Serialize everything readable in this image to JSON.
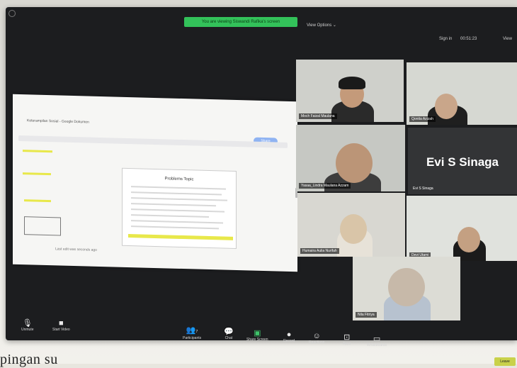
{
  "top": {
    "share_banner": "You are viewing Siswandi Rafika's screen",
    "view_options": "View Options ⌄",
    "sign_in": "Sign in",
    "timer": "00:51:23",
    "view": "View"
  },
  "shared_doc": {
    "tab_title": "Keterampilan Sosial - Google Dokumen",
    "share_button": "Share",
    "page_title": "Problems Topic",
    "status_text": "Last edit was seconds ago"
  },
  "participants": [
    {
      "name": "Moch Faizal Maulana"
    },
    {
      "name": "Qonita Azizah"
    },
    {
      "name": "Yasaa_Lindra Maulana Azzam"
    },
    {
      "name": "Evi S Sinaga",
      "video_off": true,
      "display_name": "Evi S Sinaga"
    },
    {
      "name": "Humaira Aulia Nurifah"
    },
    {
      "name": "Devi Utami"
    },
    {
      "name": "Nila Fitriya"
    }
  ],
  "controls": {
    "unmute": "Unmute",
    "start_video": "Start Video",
    "participants": "Participants",
    "participants_count": "7",
    "chat": "Chat",
    "share_screen": "Share Screen",
    "record": "Record",
    "reactions": "Reactions",
    "apps": "Apps",
    "whiteboards": "Whiteboards",
    "end": "Leave"
  },
  "caption": "pingan su",
  "colors": {
    "banner": "#33c25a",
    "end_button": "#c9d14a",
    "screen_bg": "#1c1d1f"
  }
}
